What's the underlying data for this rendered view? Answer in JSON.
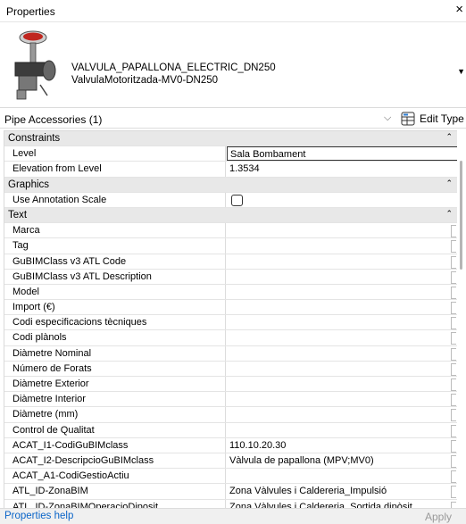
{
  "window": {
    "title": "Properties",
    "close_glyph": "×",
    "close_icon": "close-icon"
  },
  "type": {
    "name_line1": "VALVULA_PAPALLONA_ELECTRIC_DN250",
    "name_line2": "ValvulaMotoritzada-MV0-DN250",
    "thumbnail_icon": "valve-icon",
    "dropdown_icon": "triangle-down-icon"
  },
  "selector": {
    "category": "Pipe Accessories (1)",
    "chevron": "⌵",
    "edit_type_label": "Edit Type",
    "edit_type_icon": "edit-type-icon"
  },
  "groups": {
    "constraints": "Constraints",
    "graphics": "Graphics",
    "text": "Text",
    "collapse_glyph": "⌃"
  },
  "constraints": [
    {
      "name": "Level",
      "value": "Sala Bombament"
    },
    {
      "name": "Elevation from Level",
      "value": "1.3534"
    }
  ],
  "graphics": [
    {
      "name": "Use Annotation Scale",
      "checked": false
    }
  ],
  "text_rows": [
    {
      "name": "Marca",
      "value": ""
    },
    {
      "name": "Tag",
      "value": ""
    },
    {
      "name": "GuBIMClass v3 ATL Code",
      "value": ""
    },
    {
      "name": "GuBIMClass v3 ATL Description",
      "value": ""
    },
    {
      "name": "Model",
      "value": ""
    },
    {
      "name": "Import (€)",
      "value": ""
    },
    {
      "name": "Codi especificacions tècniques",
      "value": ""
    },
    {
      "name": "Codi plànols",
      "value": ""
    },
    {
      "name": "Diàmetre Nominal",
      "value": ""
    },
    {
      "name": "Número de Forats",
      "value": ""
    },
    {
      "name": "Diàmetre Exterior",
      "value": ""
    },
    {
      "name": "Diàmetre Interior",
      "value": ""
    },
    {
      "name": "Diàmetre (mm)",
      "value": ""
    },
    {
      "name": "Control de Qualitat",
      "value": ""
    },
    {
      "name": "ACAT_I1-CodiGuBIMclass",
      "value": "110.10.20.30"
    },
    {
      "name": "ACAT_I2-DescripcioGuBIMclass",
      "value": "Vàlvula de papallona (MPV;MV0)"
    },
    {
      "name": "ACAT_A1-CodiGestioActiu",
      "value": ""
    },
    {
      "name": "ATL_ID-ZonaBIM",
      "value": "Zona Vàlvules i Caldereria_Impulsió"
    },
    {
      "name": "ATL_ID-ZonaBIMOperacioDiposit",
      "value": "Zona Vàlvules i Caldereria_Sortida dipòsit"
    }
  ],
  "footer": {
    "help_link": "Properties help",
    "apply_label": "Apply"
  },
  "colors": {
    "link": "#0a64c8",
    "group_bg": "#e8e8e8",
    "valve_red": "#c0261f"
  }
}
